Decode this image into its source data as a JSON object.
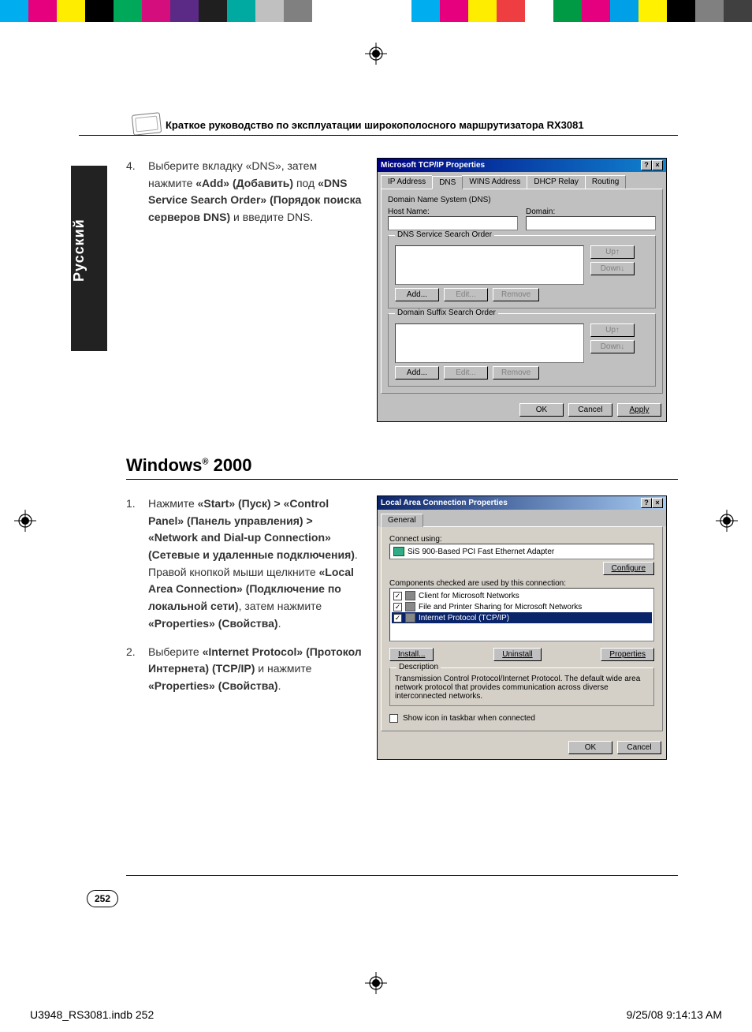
{
  "colorbar_left": [
    "#00aeef",
    "#e6007e",
    "#ffed00",
    "#000000",
    "#00a859",
    "#d40f7d",
    "#5b2a86",
    "#1f1f1f",
    "#00aaa0",
    "#c0c0c0",
    "#808080",
    "#ffffff"
  ],
  "colorbar_right": [
    "#00aeef",
    "#e6007e",
    "#ffed00",
    "#ef3e42",
    "#ffffff",
    "#009944",
    "#e4007f",
    "#00a0e9",
    "#fff100",
    "#000000",
    "#808080",
    "#404040"
  ],
  "header": {
    "title": "Краткое руководство по эксплуатации широкополосного маршрутизатора RX3081"
  },
  "side_tab": "Русский",
  "step4": {
    "num": "4.",
    "t1": "Выберите вкладку «DNS», затем нажмите ",
    "b1": "«Add» (Добавить)",
    "t2": " под ",
    "b2": "«DNS Service Search Order» (Порядок поиска серверов DNS)",
    "t3": " и введите DNS."
  },
  "dlg1": {
    "title": "Microsoft TCP/IP Properties",
    "help": "?",
    "close": "×",
    "tabs": [
      "IP Address",
      "DNS",
      "WINS Address",
      "DHCP Relay",
      "Routing"
    ],
    "active_tab": 1,
    "grp1_title": "Domain Name System (DNS)",
    "host_label": "Host Name:",
    "domain_label": "Domain:",
    "grp2_title": "DNS Service Search Order",
    "grp3_title": "Domain Suffix Search Order",
    "btn_up": "Up↑",
    "btn_down": "Down↓",
    "btn_add": "Add...",
    "btn_edit": "Edit...",
    "btn_remove": "Remove",
    "btn_ok": "OK",
    "btn_cancel": "Cancel",
    "btn_apply": "Apply"
  },
  "section_title": "Windows® 2000",
  "step1b": {
    "num": "1.",
    "t1": "Нажмите ",
    "b1": "«Start» (Пуск) > «Control Panel» (Панель управления) > «Network and Dial-up Connection» (Сетевые и удаленные подключения)",
    "t2": ". Правой кнопкой мыши щелкните ",
    "b2": "«Local Area Connection» (Подключение по локальной сети)",
    "t3": ", затем нажмите ",
    "b3": "«Properties» (Свойства)",
    "t4": "."
  },
  "step2b": {
    "num": "2.",
    "t1": "Выберите ",
    "b1": "«Internet Protocol» (Протокол Интернета) (TCP/IP)",
    "t2": " и нажмите ",
    "b2": "«Properties» (Свойства)",
    "t3": "."
  },
  "dlg2": {
    "title": "Local Area Connection Properties",
    "help": "?",
    "close": "×",
    "tab_general": "General",
    "connect_using": "Connect using:",
    "adapter": "SiS 900-Based PCI Fast Ethernet Adapter",
    "btn_configure": "Configure",
    "comps_label": "Components checked are used by this connection:",
    "comps": [
      "Client for Microsoft Networks",
      "File and Printer Sharing for Microsoft Networks",
      "Internet Protocol (TCP/IP)"
    ],
    "btn_install": "Install...",
    "btn_uninstall": "Uninstall",
    "btn_properties": "Properties",
    "desc_title": "Description",
    "desc_text": "Transmission Control Protocol/Internet Protocol. The default wide area network protocol that provides communication across diverse interconnected networks.",
    "show_icon": "Show icon in taskbar when connected",
    "btn_ok": "OK",
    "btn_cancel": "Cancel"
  },
  "page_number": "252",
  "print_footer_left": "U3948_RS3081.indb   252",
  "print_footer_right": "9/25/08   9:14:13 AM"
}
